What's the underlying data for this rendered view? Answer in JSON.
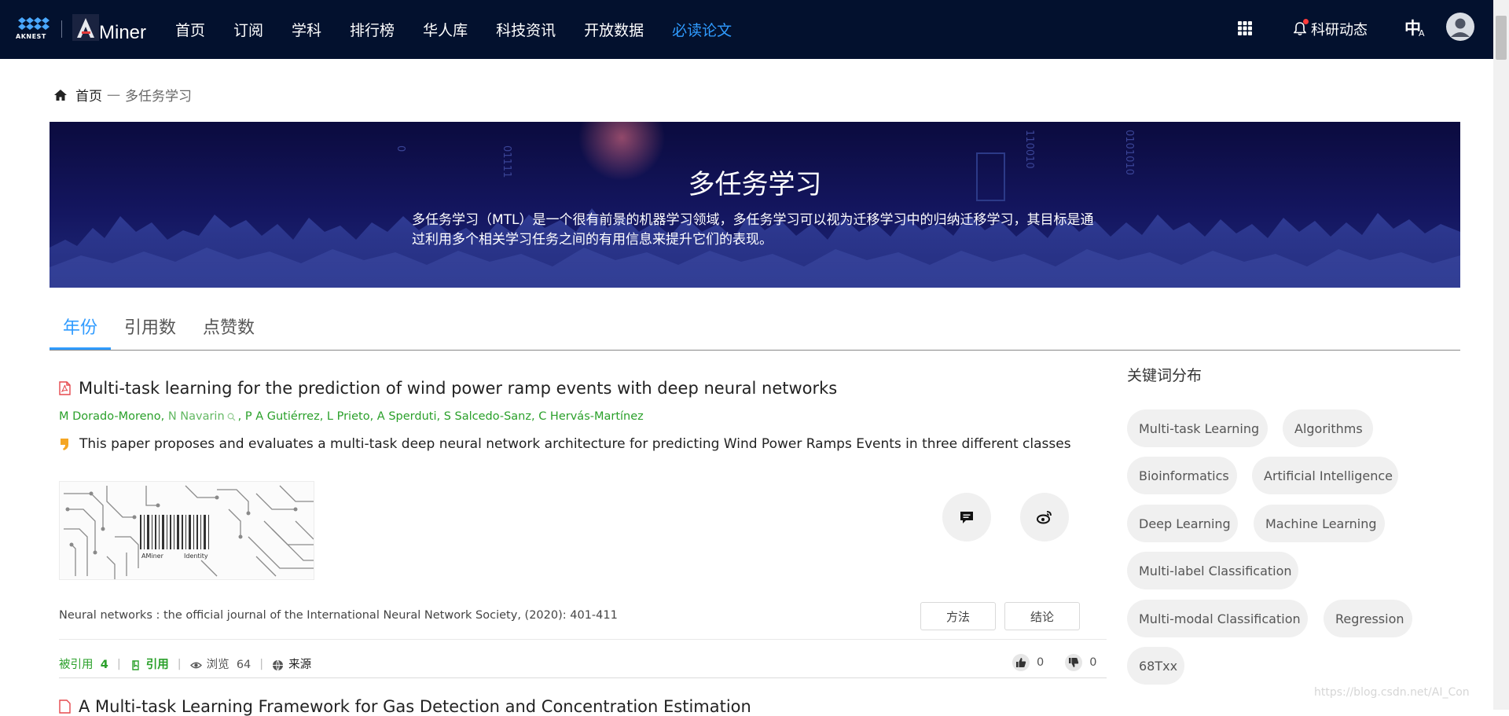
{
  "nav": {
    "logo_left_text": "AKNEST",
    "logo_brand": "Miner",
    "items": [
      "首页",
      "订阅",
      "学科",
      "排行榜",
      "华人库",
      "科技资讯",
      "开放数据",
      "必读论文"
    ],
    "active_index": 7,
    "notifications_label": "科研动态",
    "lang_label": "中",
    "lang_sub": "A"
  },
  "breadcrumb": {
    "home": "首页",
    "separator": "一",
    "current": "多任务学习"
  },
  "banner": {
    "title": "多任务学习",
    "description": "多任务学习（MTL）是一个很有前景的机器学习领域，多任务学习可以视为迁移学习中的归纳迁移学习，其目标是通过利用多个相关学习任务之间的有用信息来提升它们的表现。",
    "bg_digits": [
      "0",
      "01111",
      "110010",
      "0101010"
    ]
  },
  "tabs": [
    {
      "label": "年份",
      "active": true
    },
    {
      "label": "引用数",
      "active": false
    },
    {
      "label": "点赞数",
      "active": false
    }
  ],
  "paper": {
    "title": "Multi-task learning for the prediction of wind power ramp events with deep neural networks",
    "authors": [
      "M Dorado-Moreno",
      "N Navarin",
      "P A Gutiérrez",
      "L Prieto",
      "A Sperduti",
      "S Salcedo-Sanz",
      "C Hervás-Martínez"
    ],
    "author_sep": ",",
    "abstract": "This paper proposes and evaluates a multi-task deep neural network architecture for predicting Wind Power Ramps Events in three different classes",
    "thumb_caption_left": "AMiner",
    "thumb_caption_right": "Identity",
    "venue": "Neural networks : the official journal of the International Neural Network Society, (2020): 401-411",
    "tag_method": "方法",
    "tag_conclusion": "结论",
    "cited_label": "被引用",
    "cited_count": "4",
    "cite_label": "引用",
    "views_label": "浏览",
    "views_count": "64",
    "source_label": "来源",
    "likes": "0",
    "dislikes": "0"
  },
  "next_paper": {
    "title": "A Multi-task Learning Framework for Gas Detection and Concentration Estimation"
  },
  "keywords": {
    "title": "关键词分布",
    "items": [
      "Multi-task Learning",
      "Algorithms",
      "Bioinformatics",
      "Artificial Intelligence",
      "Deep Learning",
      "Machine Learning",
      "Multi-label Classification",
      "Multi-modal Classification",
      "Regression",
      "68Txx"
    ]
  },
  "watermark": "https://blog.csdn.net/AI_Con",
  "colors": {
    "nav_bg": "#03112e",
    "accent": "#2f9bff",
    "author_green": "#2aa02a",
    "banner_bg": "#141660"
  }
}
